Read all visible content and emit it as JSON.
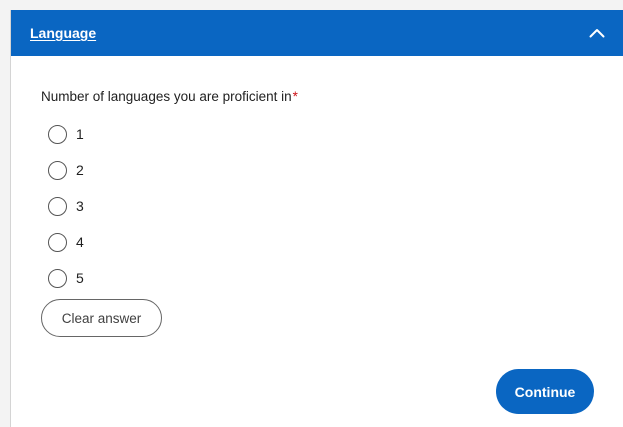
{
  "section": {
    "title": "Language",
    "collapse_icon": "chevron-up-icon"
  },
  "question": {
    "label": "Number of languages you are proficient in",
    "required_marker": "*",
    "options": [
      {
        "label": "1",
        "selected": false
      },
      {
        "label": "2",
        "selected": false
      },
      {
        "label": "3",
        "selected": false
      },
      {
        "label": "4",
        "selected": false
      },
      {
        "label": "5",
        "selected": false
      }
    ]
  },
  "actions": {
    "clear_label": "Clear answer",
    "continue_label": "Continue"
  },
  "colors": {
    "brand": "#0a66c2",
    "required": "#cc1016"
  }
}
